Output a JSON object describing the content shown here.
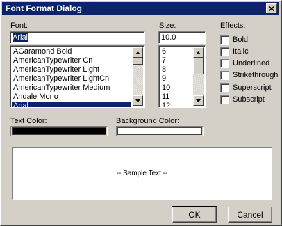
{
  "window": {
    "title": "Font Format Dialog",
    "close_glyph": "✕"
  },
  "font": {
    "label": "Font:",
    "value": "Arial",
    "items": [
      "AGaramond Bold",
      "AmericanTypewriter Cn",
      "AmericanTypewriter Light",
      "AmericanTypewriter LightCn",
      "AmericanTypewriter Medium",
      "Andale Mono",
      "Arial"
    ],
    "selected_index": 6
  },
  "size": {
    "label": "Size:",
    "value": "10.0",
    "items": [
      "6",
      "7",
      "8",
      "9",
      "10",
      "11",
      "12"
    ]
  },
  "effects": {
    "label": "Effects:",
    "items": [
      {
        "label": "Bold",
        "checked": false
      },
      {
        "label": "Italic",
        "checked": false
      },
      {
        "label": "Underlined",
        "checked": false
      },
      {
        "label": "Strikethrough",
        "checked": false
      },
      {
        "label": "Superscript",
        "checked": false
      },
      {
        "label": "Subscript",
        "checked": false
      }
    ]
  },
  "text_color": {
    "label": "Text Color:",
    "color": "#000000"
  },
  "background_color": {
    "label": "Background Color:",
    "color": "#ffffff"
  },
  "sample": {
    "text": "-- Sample Text --"
  },
  "buttons": {
    "ok": "OK",
    "cancel": "Cancel"
  },
  "icons": {
    "close": "close-icon",
    "scroll_up": "arrow-up-icon",
    "scroll_down": "arrow-down-icon"
  }
}
